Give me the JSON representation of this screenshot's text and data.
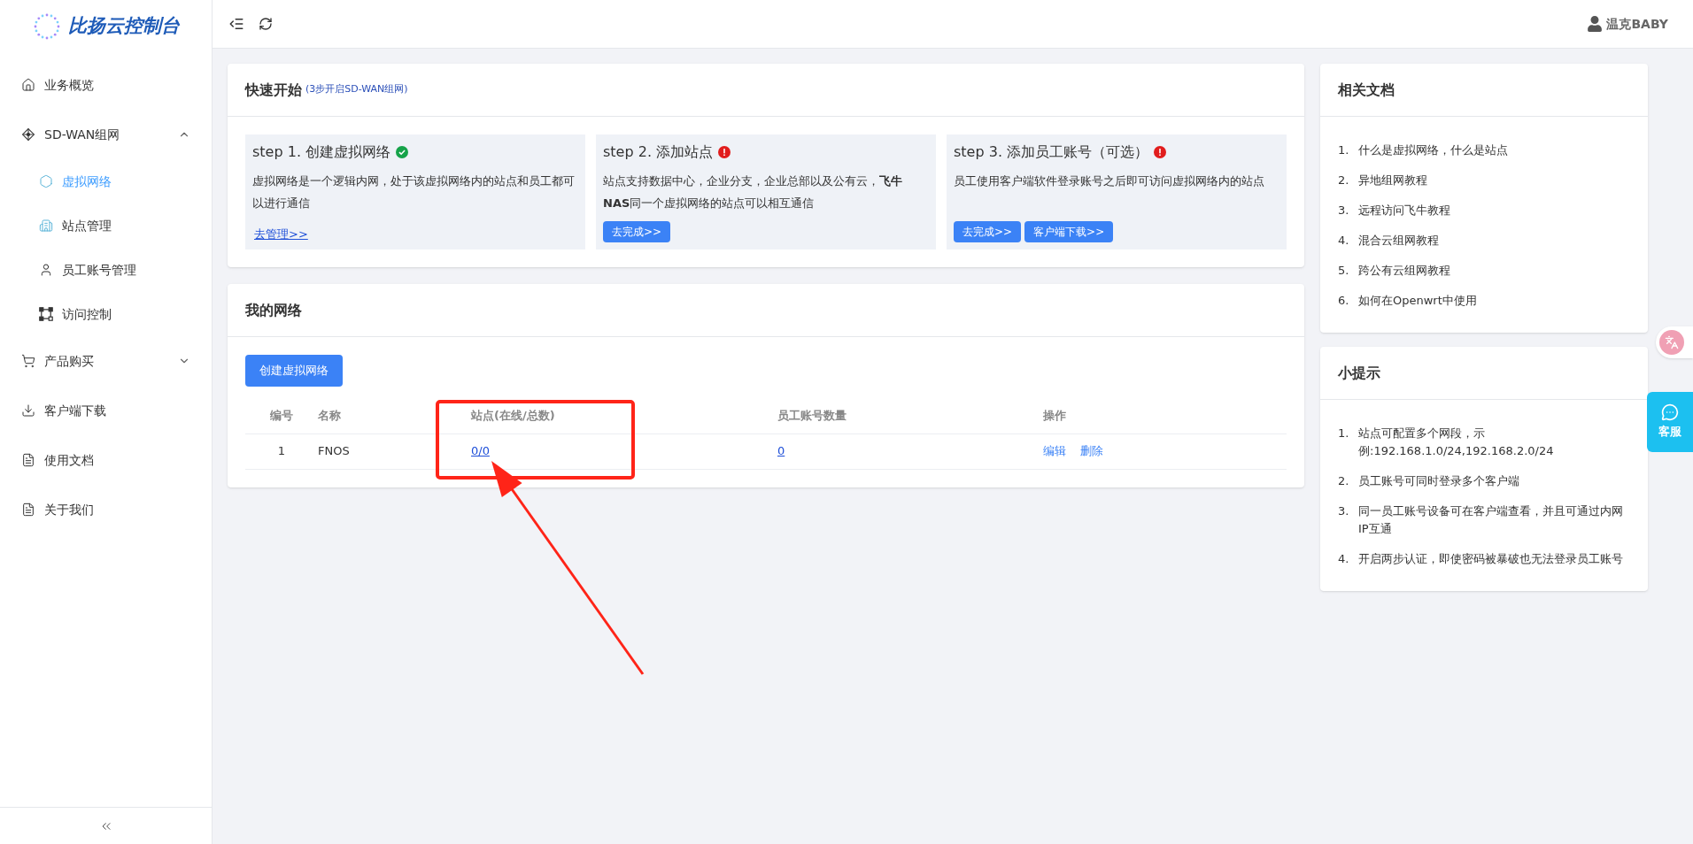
{
  "brand": {
    "name": "比扬云控制台"
  },
  "header": {
    "user": "温克BABY"
  },
  "sidebar": {
    "items": [
      {
        "label": "业务概览",
        "selected": false
      },
      {
        "label": "SD-WAN组网",
        "selected": false,
        "expanded": true,
        "children": [
          {
            "label": "虚拟网络",
            "selected": true
          },
          {
            "label": "站点管理",
            "selected": false
          },
          {
            "label": "员工账号管理",
            "selected": false
          },
          {
            "label": "访问控制",
            "selected": false
          }
        ]
      },
      {
        "label": "产品购买",
        "selected": false,
        "expanded": false
      },
      {
        "label": "客户端下载",
        "selected": false
      },
      {
        "label": "使用文档",
        "selected": false
      },
      {
        "label": "关于我们",
        "selected": false
      }
    ]
  },
  "quick_start": {
    "title": "快速开始",
    "subtitle": "(3步开启SD-WAN组网)",
    "steps": [
      {
        "title": "step 1. 创建虚拟网络",
        "done": true,
        "description": "虚拟网络是一个逻辑内网，处于该虚拟网络内的站点和员工都可以进行通信",
        "actions": [
          {
            "kind": "link",
            "label": "去管理>>"
          }
        ]
      },
      {
        "title": "step 2. 添加站点",
        "done": false,
        "description": "站点支持数据中心，企业分支，企业总部以及公有云，**飞牛NAS**同一个虚拟网络的站点可以相互通信",
        "actions": [
          {
            "kind": "button",
            "label": "去完成>>"
          }
        ]
      },
      {
        "title": "step 3. 添加员工账号（可选）",
        "done": false,
        "description": "员工使用客户端软件登录账号之后即可访问虚拟网络内的站点",
        "actions": [
          {
            "kind": "button",
            "label": "去完成>>"
          },
          {
            "kind": "button",
            "label": "客户端下载>>"
          }
        ]
      }
    ]
  },
  "my_networks": {
    "title": "我的网络",
    "create_button": "创建虚拟网络",
    "columns": [
      "编号",
      "名称",
      "站点(在线/总数)",
      "员工账号数量",
      "操作"
    ],
    "rows": [
      {
        "index": "1",
        "name": "FNOS",
        "sites": "0/0",
        "employees": "0",
        "actions": [
          "编辑",
          "删除"
        ]
      }
    ]
  },
  "docs": {
    "title": "相关文档",
    "items": [
      {
        "number": "1.",
        "label": "什么是虚拟网络，什么是站点"
      },
      {
        "number": "2.",
        "label": "异地组网教程"
      },
      {
        "number": "3.",
        "label": "远程访问飞牛教程"
      },
      {
        "number": "4.",
        "label": "混合云组网教程"
      },
      {
        "number": "5.",
        "label": "跨公有云组网教程"
      },
      {
        "number": "6.",
        "label": "如何在Openwrt中使用"
      }
    ]
  },
  "tips": {
    "title": "小提示",
    "items": [
      {
        "number": "1.",
        "label": "站点可配置多个网段，示例:192.168.1.0/24,192.168.2.0/24"
      },
      {
        "number": "2.",
        "label": "员工账号可同时登录多个客户端"
      },
      {
        "number": "3.",
        "label": "同一员工账号设备可在客户端查看，并且可通过内网IP互通"
      },
      {
        "number": "4.",
        "label": "开启两步认证，即使密码被暴破也无法登录员工账号"
      }
    ]
  },
  "floating": {
    "service_label": "客服"
  }
}
